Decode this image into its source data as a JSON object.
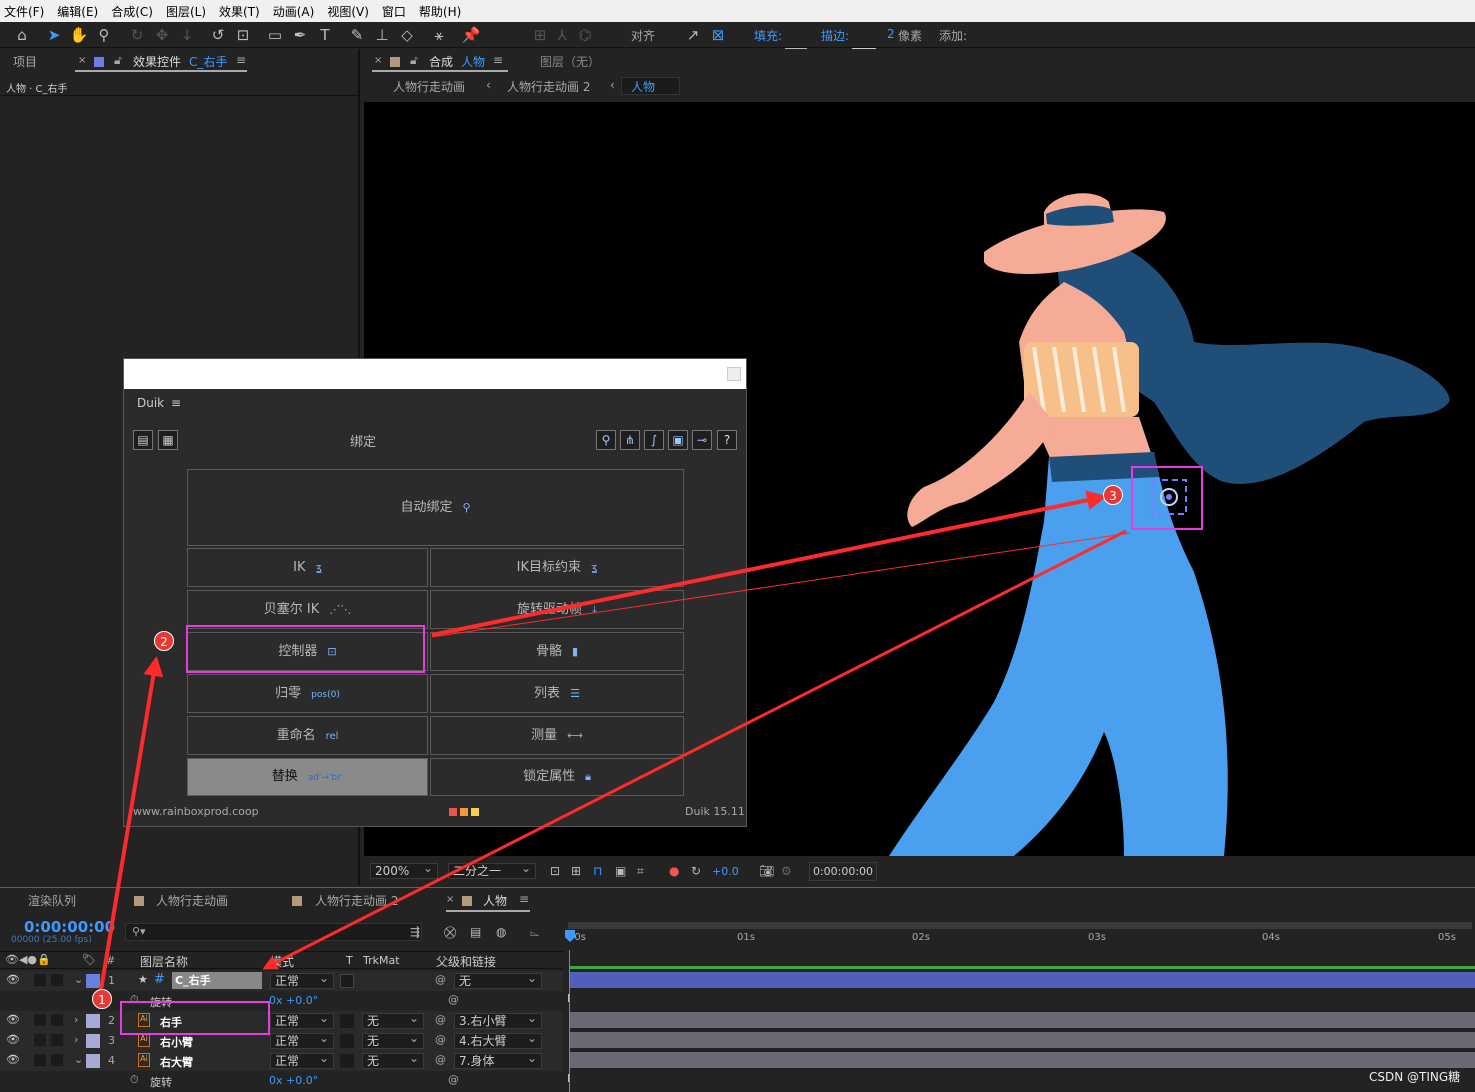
{
  "menu": [
    "文件(F)",
    "编辑(E)",
    "合成(C)",
    "图层(L)",
    "效果(T)",
    "动画(A)",
    "视图(V)",
    "窗口",
    "帮助(H)"
  ],
  "toolbar": {
    "align_label": "对齐",
    "fill_label": "填充:",
    "fill_value": "?",
    "stroke_label": "描边:",
    "stroke_width": "2",
    "stroke_unit": "像素",
    "add_label": "添加:"
  },
  "left_panel": {
    "tab_project": "项目",
    "tab_effects": "效果控件",
    "tab_effects_layer": "C_右手",
    "breadcrumb": "人物 · C_右手"
  },
  "viewer": {
    "tab_comp": "合成",
    "tab_comp_name": "人物",
    "tab_layer": "图层（无）",
    "breadcrumbs": [
      "人物行走动画",
      "人物行走动画 2",
      "人物"
    ],
    "zoom": "200%",
    "resolution": "二分之一",
    "exposure": "+0.0",
    "timecode": "0:00:00:00"
  },
  "duik": {
    "menu_label": "Duik",
    "section_title": "绑定",
    "btn_autorig": "自动绑定",
    "btn_ik": "IK",
    "btn_ik_goal": "IK目标约束",
    "btn_bezier_ik": "贝塞尔 IK",
    "btn_rotation_morph": "旋转驱动帧",
    "btn_controller": "控制器",
    "btn_bone": "骨骼",
    "btn_zero": "归零",
    "zero_icon_text": "pos(0)",
    "btn_list": "列表",
    "btn_rename": "重命名",
    "rename_icon_text": "rel",
    "btn_measure": "测量",
    "btn_replace": "替换",
    "replace_icon_text": "ad'→'br'",
    "btn_lock": "锁定属性",
    "footer_url": "www.rainboxprod.coop",
    "version": "Duik 15.11",
    "help_icon": "?"
  },
  "timeline": {
    "tab_render": "渲染队列",
    "tab_walk1": "人物行走动画",
    "tab_walk2": "人物行走动画 2",
    "tab_person": "人物",
    "timecode": "0:00:00:00",
    "frames": "00000 (25.00 fps)",
    "col_layer_name": "图层名称",
    "col_mode": "模式",
    "col_t": "T",
    "col_trkmat": "TrkMat",
    "col_parent": "父级和链接",
    "ruler": [
      "00s",
      "01s",
      "02s",
      "03s",
      "04s",
      "05s"
    ],
    "layers": [
      {
        "num": "1",
        "name": "C_右手",
        "mode": "正常",
        "trkmat": "",
        "parent": "无"
      },
      {
        "num": "2",
        "name": "右手",
        "mode": "正常",
        "trkmat": "无",
        "parent": "3.右小臂"
      },
      {
        "num": "3",
        "name": "右小臂",
        "mode": "正常",
        "trkmat": "无",
        "parent": "4.右大臂"
      },
      {
        "num": "4",
        "name": "右大臂",
        "mode": "正常",
        "trkmat": "无",
        "parent": "7.身体"
      }
    ],
    "prop_rotation": "旋转",
    "rotation_value": "0x +0.0°"
  },
  "annotations": {
    "badge1": "1",
    "badge2": "2",
    "badge3": "3"
  },
  "watermark": "CSDN @TING糖",
  "colors": {
    "accent_blue": "#3d9bff",
    "highlight_magenta": "#e83be0",
    "arrow_red": "#ff2b2b",
    "layer_label_blue": "#6b7fe0",
    "layer_label_lavender": "#a7a9d6",
    "track_bar_blue": "#5060b8"
  }
}
